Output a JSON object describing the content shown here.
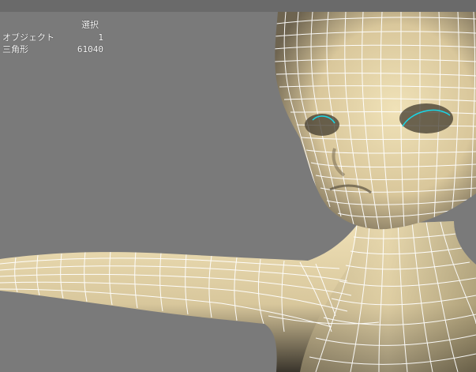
{
  "hud": {
    "header": "選択",
    "rows": [
      {
        "label": "オブジェクト",
        "value": "1"
      },
      {
        "label": "三角形",
        "value": "61040"
      }
    ]
  },
  "colors": {
    "viewport_bg": "#7a7a7a",
    "top_bar": "#6a6a6a",
    "skin": "#e3d3a8",
    "wire": "#ffffff",
    "selection_edge": "#19d6e6",
    "hud_text": "#ffffff"
  },
  "scene": {
    "subject": "3d-character-head-and-torso-wireframe",
    "shading": "smooth-shaded-with-wireframe-on-shaded"
  }
}
